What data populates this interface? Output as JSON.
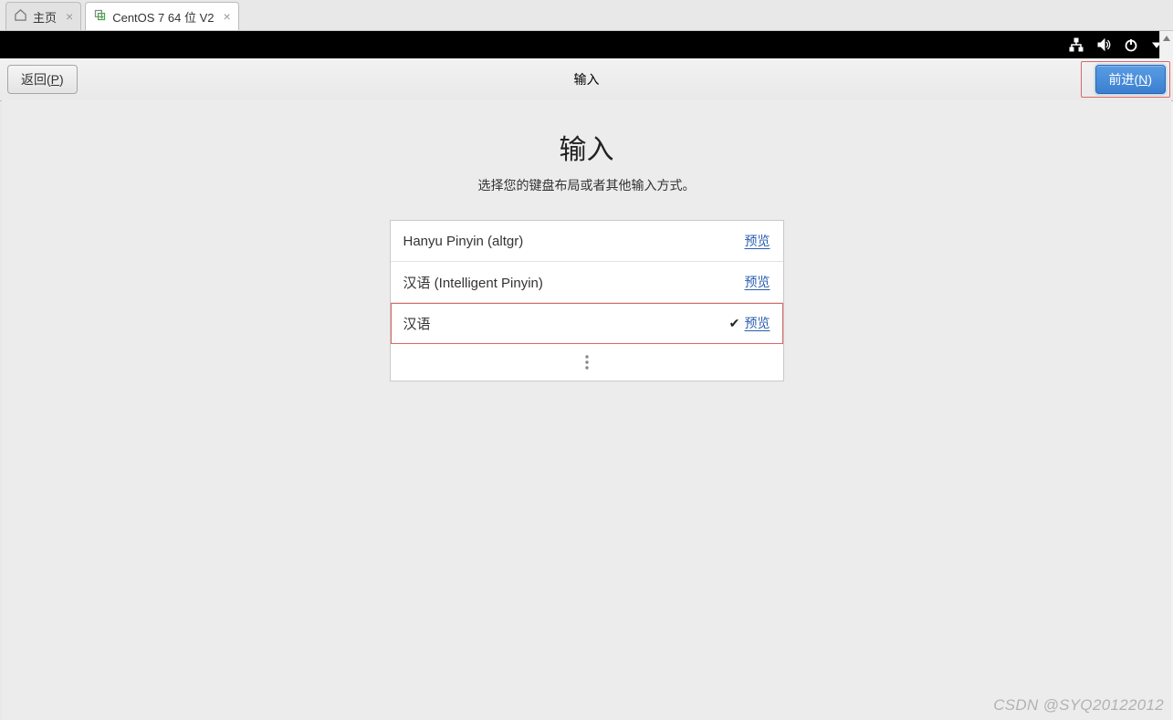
{
  "tabs": [
    {
      "label": "主页",
      "active": false
    },
    {
      "label": "CentOS 7 64 位 V2",
      "active": true
    }
  ],
  "topbar": {
    "icons": [
      "network-icon",
      "volume-icon",
      "power-icon",
      "dropdown-icon"
    ]
  },
  "actionbar": {
    "back_label_prefix": "返回(",
    "back_label_key": "P",
    "back_label_suffix": ")",
    "title": "输入",
    "next_label_prefix": "前进(",
    "next_label_key": "N",
    "next_label_suffix": ")"
  },
  "main": {
    "heading": "输入",
    "subtitle": "选择您的键盘布局或者其他输入方式。",
    "preview_label": "预览",
    "items": [
      {
        "label": "Hanyu Pinyin (altgr)",
        "selected": false
      },
      {
        "label": "汉语  (Intelligent Pinyin)",
        "selected": false
      },
      {
        "label": "汉语",
        "selected": true
      }
    ]
  },
  "watermark": "CSDN @SYQ20122012"
}
